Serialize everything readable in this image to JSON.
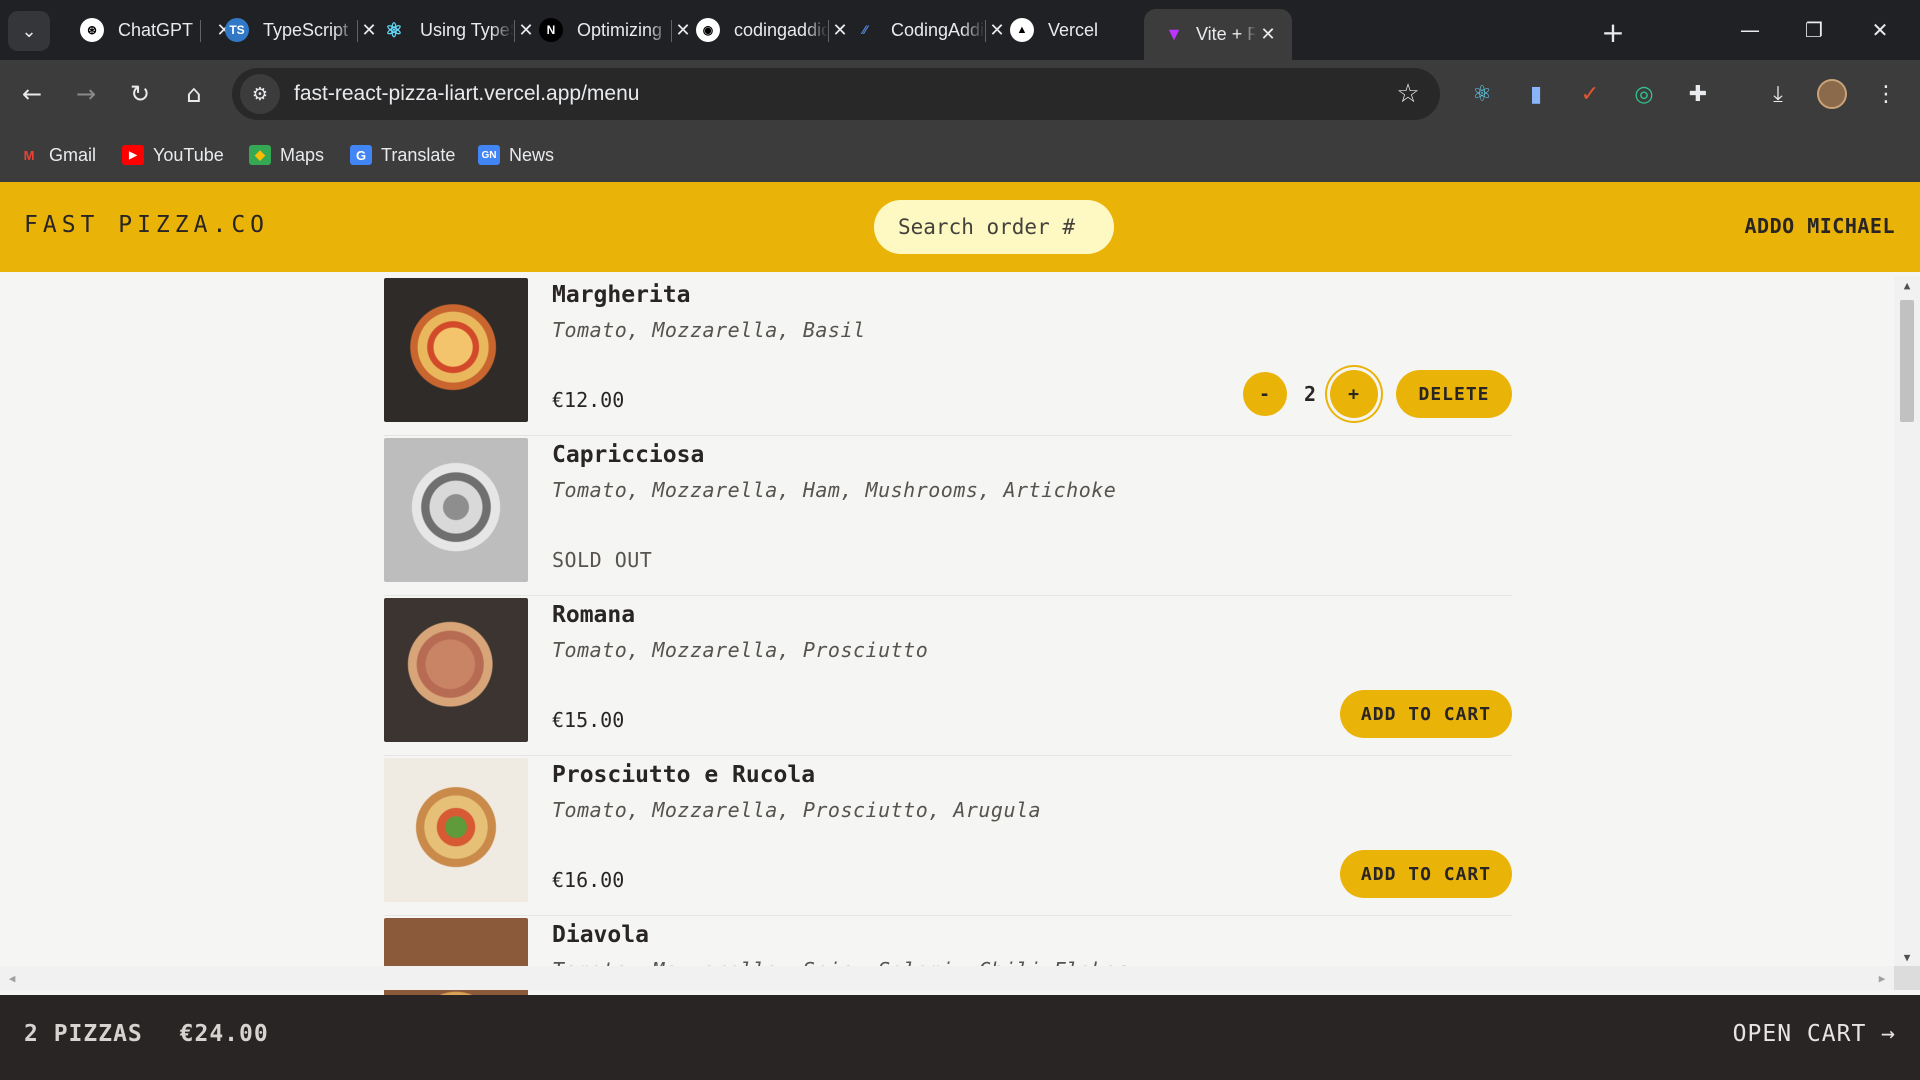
{
  "browser": {
    "tabs": [
      {
        "title": "ChatGPT",
        "icon": "chatgpt-icon",
        "active": false
      },
      {
        "title": "TypeScript",
        "icon": "typescript-icon",
        "active": false
      },
      {
        "title": "Using TypeScript",
        "icon": "react-icon",
        "active": false
      },
      {
        "title": "Optimizing",
        "icon": "notion-icon",
        "active": false
      },
      {
        "title": "codingaddict",
        "icon": "github-icon",
        "active": false
      },
      {
        "title": "CodingAddict",
        "icon": "codingaddict-icon",
        "active": false
      },
      {
        "title": "Vercel",
        "icon": "vercel-icon",
        "active": false
      },
      {
        "title": "Vite + React",
        "icon": "vite-icon",
        "active": true
      }
    ],
    "url": "fast-react-pizza-liart.vercel.app/menu",
    "bookmarks": [
      {
        "label": "Gmail",
        "icon": "gmail-icon"
      },
      {
        "label": "YouTube",
        "icon": "youtube-icon"
      },
      {
        "label": "Maps",
        "icon": "maps-icon"
      },
      {
        "label": "Translate",
        "icon": "translate-icon"
      },
      {
        "label": "News",
        "icon": "news-icon"
      }
    ]
  },
  "header": {
    "logo": "FAST PIZZA.CO",
    "search_placeholder": "Search order #",
    "username": "ADDO MICHAEL"
  },
  "menu": {
    "items": [
      {
        "name": "Margherita",
        "ingredients": "Tomato, Mozzarella, Basil",
        "price": "€12.00",
        "sold_out": false,
        "in_cart": true,
        "quantity": "2",
        "decrease_label": "-",
        "increase_label": "+",
        "delete_label": "DELETE"
      },
      {
        "name": "Capricciosa",
        "ingredients": "Tomato, Mozzarella, Ham, Mushrooms, Artichoke",
        "sold_out": true,
        "sold_out_label": "SOLD OUT"
      },
      {
        "name": "Romana",
        "ingredients": "Tomato, Mozzarella, Prosciutto",
        "price": "€15.00",
        "sold_out": false,
        "add_label": "ADD TO CART"
      },
      {
        "name": "Prosciutto e Rucola",
        "ingredients": "Tomato, Mozzarella, Prosciutto, Arugula",
        "price": "€16.00",
        "sold_out": false,
        "add_label": "ADD TO CART"
      },
      {
        "name": "Diavola",
        "ingredients": "Tomato, Mozzarella, Spicy Salami, Chili Flakes"
      }
    ]
  },
  "cart": {
    "count": "2 PIZZAS",
    "total": "€24.00",
    "open_label": "OPEN CART →"
  },
  "colors": {
    "brand_yellow": "#eab308",
    "search_bg": "#fef9c3",
    "cart_bar_bg": "#292524",
    "page_bg": "#f5f5f4"
  }
}
